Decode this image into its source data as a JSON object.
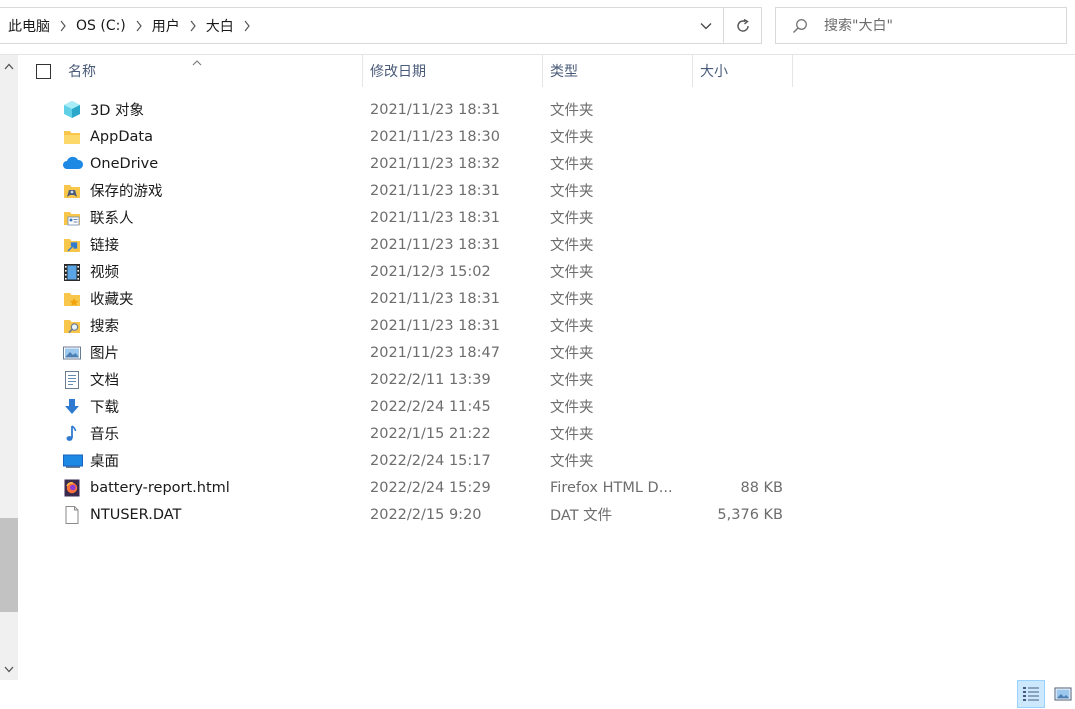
{
  "address": {
    "crumbs": [
      {
        "label": "此电脑"
      },
      {
        "label": "OS (C:)"
      },
      {
        "label": "用户"
      },
      {
        "label": "大白"
      }
    ]
  },
  "search": {
    "placeholder": "搜索\"大白\""
  },
  "columns": {
    "name": "名称",
    "date": "修改日期",
    "type": "类型",
    "size": "大小"
  },
  "files": [
    {
      "name": "3D 对象",
      "date": "2021/11/23 18:31",
      "type": "文件夹",
      "size": "",
      "icon": "3d-objects-icon"
    },
    {
      "name": "AppData",
      "date": "2021/11/23 18:30",
      "type": "文件夹",
      "size": "",
      "icon": "folder-icon"
    },
    {
      "name": "OneDrive",
      "date": "2021/11/23 18:32",
      "type": "文件夹",
      "size": "",
      "icon": "onedrive-cloud-icon"
    },
    {
      "name": "保存的游戏",
      "date": "2021/11/23 18:31",
      "type": "文件夹",
      "size": "",
      "icon": "saved-games-icon"
    },
    {
      "name": "联系人",
      "date": "2021/11/23 18:31",
      "type": "文件夹",
      "size": "",
      "icon": "contacts-icon"
    },
    {
      "name": "链接",
      "date": "2021/11/23 18:31",
      "type": "文件夹",
      "size": "",
      "icon": "links-icon"
    },
    {
      "name": "视频",
      "date": "2021/12/3 15:02",
      "type": "文件夹",
      "size": "",
      "icon": "videos-icon"
    },
    {
      "name": "收藏夹",
      "date": "2021/11/23 18:31",
      "type": "文件夹",
      "size": "",
      "icon": "favorites-icon"
    },
    {
      "name": "搜索",
      "date": "2021/11/23 18:31",
      "type": "文件夹",
      "size": "",
      "icon": "searches-icon"
    },
    {
      "name": "图片",
      "date": "2021/11/23 18:47",
      "type": "文件夹",
      "size": "",
      "icon": "pictures-icon"
    },
    {
      "name": "文档",
      "date": "2022/2/11 13:39",
      "type": "文件夹",
      "size": "",
      "icon": "documents-icon"
    },
    {
      "name": "下载",
      "date": "2022/2/24 11:45",
      "type": "文件夹",
      "size": "",
      "icon": "downloads-icon"
    },
    {
      "name": "音乐",
      "date": "2022/1/15 21:22",
      "type": "文件夹",
      "size": "",
      "icon": "music-icon"
    },
    {
      "name": "桌面",
      "date": "2022/2/24 15:17",
      "type": "文件夹",
      "size": "",
      "icon": "desktop-icon"
    },
    {
      "name": "battery-report.html",
      "date": "2022/2/24 15:29",
      "type": "Firefox HTML D...",
      "size": "88 KB",
      "icon": "firefox-html-icon"
    },
    {
      "name": "NTUSER.DAT",
      "date": "2022/2/15 9:20",
      "type": "DAT 文件",
      "size": "5,376 KB",
      "icon": "blank-file-icon"
    }
  ],
  "colors": {
    "header_text": "#4a5b7a",
    "meta_text": "#6d6d6d",
    "folder_yellow": "#f7c64b",
    "accent_blue": "#1e88e5",
    "active_view_bg": "#cce8ff"
  }
}
